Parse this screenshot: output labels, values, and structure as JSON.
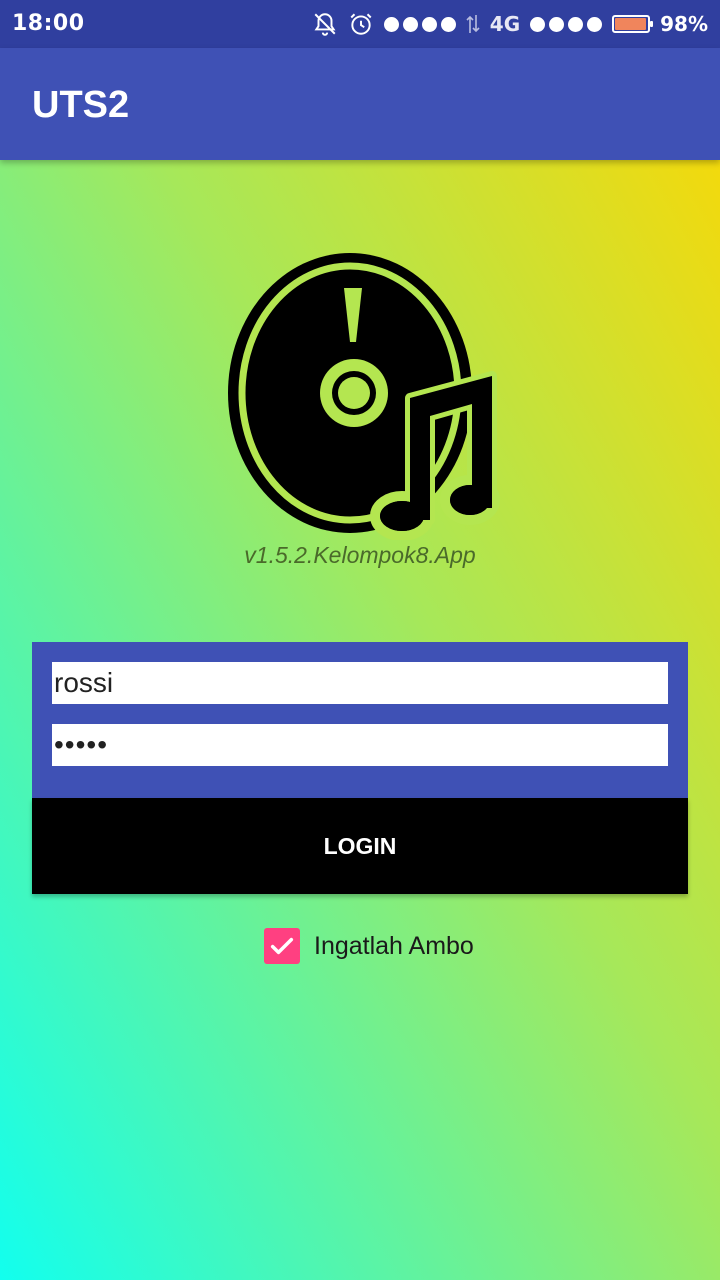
{
  "status_bar": {
    "time": "18:00",
    "network": "4G",
    "battery_percent": "98%",
    "battery_level": 0.98,
    "icons": [
      "notifications-off-icon",
      "alarm-icon",
      "signal-icon",
      "data-transfer-icon",
      "signal-icon",
      "battery-icon"
    ],
    "background_color": "#303f9f"
  },
  "app_bar": {
    "title": "UTS2",
    "background_color": "#3f51b5"
  },
  "logo": {
    "icon": "music-disc-icon",
    "version": "v1.5.2.Kelompok8.App"
  },
  "login": {
    "username_value": "rossi",
    "password_value": "12345",
    "button_label": "LOGIN",
    "button_color": "#000000"
  },
  "remember": {
    "label": "Ingatlah Ambo",
    "checked": true,
    "accent_color": "#ff4081"
  }
}
